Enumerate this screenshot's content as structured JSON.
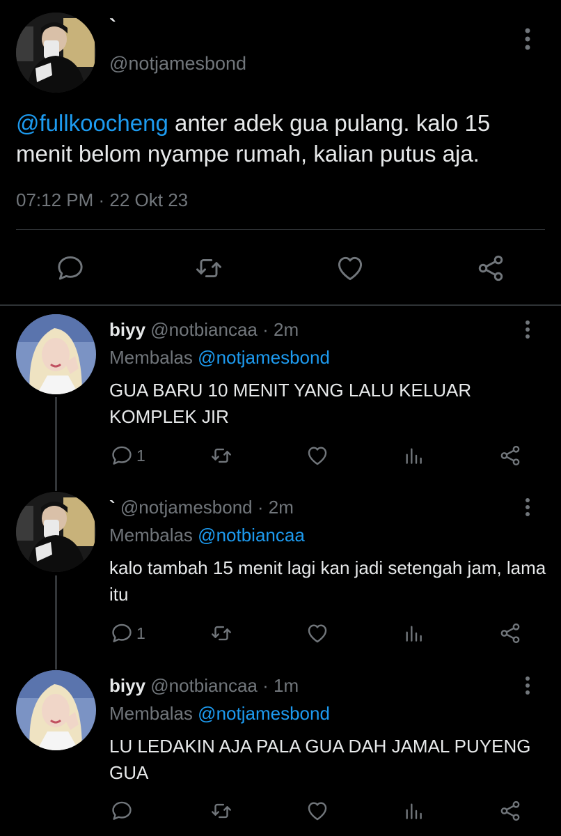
{
  "main_tweet": {
    "display_name": "`",
    "handle": "@notjamesbond",
    "mention": "@fullkoocheng",
    "text": " anter adek gua pulang. kalo 15 menit belom nyampe rumah, kalian putus aja.",
    "timestamp": "07:12 PM · 22 Okt 23",
    "actions": [
      "reply-icon",
      "retweet-icon",
      "like-icon",
      "share-icon"
    ]
  },
  "replies": [
    {
      "display_name": "biyy",
      "handle": "@notbiancaa",
      "sep": "·",
      "time": "2m",
      "replying_label": "Membalas",
      "replying_to": "@notjamesbond",
      "text": "GUA BARU 10 MENIT YANG LALU KELUAR KOMPLEK JIR",
      "reply_count": "1"
    },
    {
      "display_name": "`",
      "handle": "@notjamesbond",
      "sep": "·",
      "time": "2m",
      "replying_label": "Membalas",
      "replying_to": "@notbiancaa",
      "text": "kalo tambah 15 menit lagi kan jadi setengah jam, lama itu",
      "reply_count": "1"
    },
    {
      "display_name": "biyy",
      "handle": "@notbiancaa",
      "sep": "·",
      "time": "1m",
      "replying_label": "Membalas",
      "replying_to": "@notjamesbond",
      "text": "LU LEDAKIN AJA PALA GUA DAH JAMAL PUYENG GUA",
      "reply_count": ""
    }
  ],
  "colors": {
    "background": "#000000",
    "text": "#e7e9ea",
    "secondary": "#71767b",
    "accent": "#1d9bf0",
    "divider": "#2f3336"
  }
}
